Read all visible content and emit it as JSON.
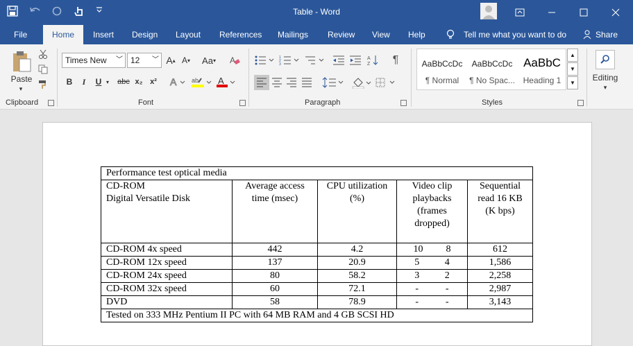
{
  "window": {
    "title": "Table  -  Word"
  },
  "menu": {
    "file": "File",
    "home": "Home",
    "insert": "Insert",
    "design": "Design",
    "layout": "Layout",
    "references": "References",
    "mailings": "Mailings",
    "review": "Review",
    "view": "View",
    "help": "Help",
    "tell_me": "Tell me what you want to do",
    "share": "Share"
  },
  "ribbon": {
    "clipboard": {
      "label": "Clipboard",
      "paste": "Paste"
    },
    "font": {
      "label": "Font",
      "name": "Times New",
      "size": "12",
      "grow": "A",
      "shrink": "A",
      "case": "Aa",
      "bold": "B",
      "italic": "I",
      "underline": "U",
      "strike": "abc",
      "sub": "x₂",
      "sup": "x²"
    },
    "paragraph": {
      "label": "Paragraph"
    },
    "styles": {
      "label": "Styles",
      "items": [
        {
          "preview": "AaBbCcDc",
          "name": "¶ Normal"
        },
        {
          "preview": "AaBbCcDc",
          "name": "¶ No Spac..."
        },
        {
          "preview": "AaBbC",
          "name": "Heading 1"
        }
      ]
    },
    "editing": {
      "label": "Editing"
    }
  },
  "document": {
    "table": {
      "title": "Performance test optical media",
      "header_col1_line1": "CD-ROM",
      "header_col1_line2": "Digital Versatile Disk",
      "header_access": "Average access time (msec)",
      "header_cpu": "CPU utilization (%)",
      "header_video": "Video clip playbacks (frames dropped)",
      "header_seq": "Sequential read 16 KB (K bps)",
      "rows": [
        {
          "name": "CD-ROM 4x speed",
          "access": "442",
          "cpu": "4.2",
          "v1": "10",
          "v2": "8",
          "seq": "612"
        },
        {
          "name": "CD-ROM 12x speed",
          "access": "137",
          "cpu": "20.9",
          "v1": "5",
          "v2": "4",
          "seq": "1,586"
        },
        {
          "name": "CD-ROM 24x speed",
          "access": "80",
          "cpu": "58.2",
          "v1": "3",
          "v2": "2",
          "seq": "2,258"
        },
        {
          "name": "CD-ROM 32x speed",
          "access": "60",
          "cpu": "72.1",
          "v1": "-",
          "v2": "-",
          "seq": "2,987"
        },
        {
          "name": "DVD",
          "access": "58",
          "cpu": "78.9",
          "v1": "-",
          "v2": "-",
          "seq": "3,143"
        }
      ],
      "footer": "Tested on 333 MHz Pentium II PC with 64 MB RAM and 4 GB SCSI HD"
    }
  },
  "colors": {
    "accent": "#2b579a",
    "ribbon": "#f3f3f3",
    "canvas": "#e6e6e6"
  }
}
